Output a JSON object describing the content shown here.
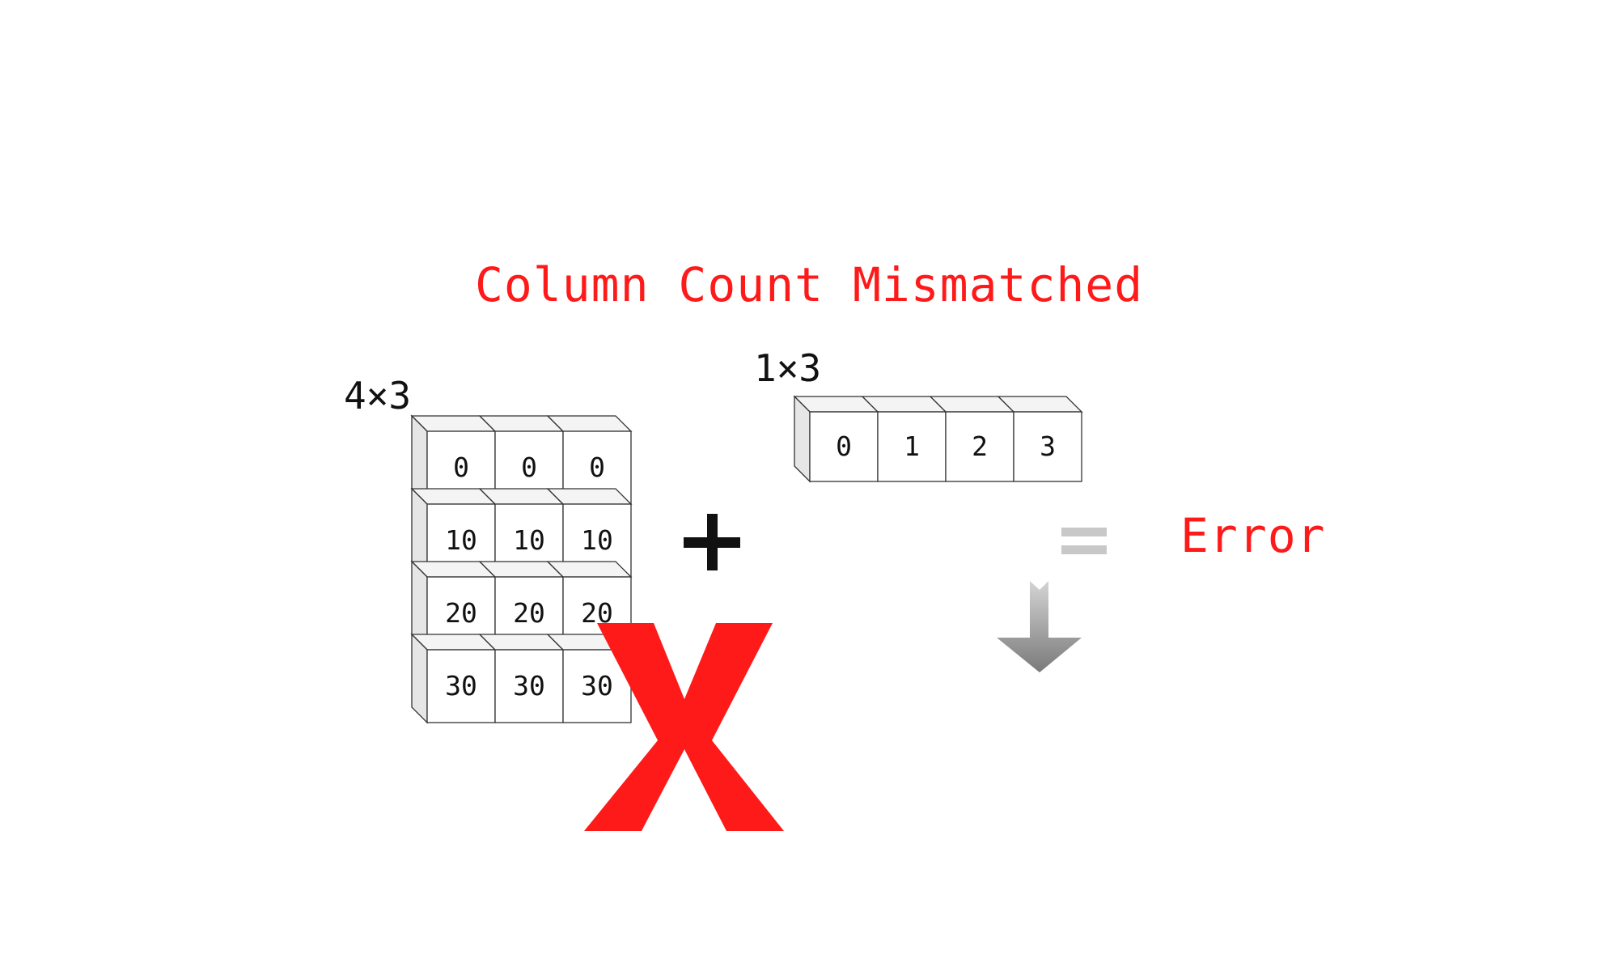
{
  "title": "Column Count Mismatched",
  "left_array": {
    "label": "4×3",
    "rows": [
      [
        "0",
        "0",
        "0"
      ],
      [
        "10",
        "10",
        "10"
      ],
      [
        "20",
        "20",
        "20"
      ],
      [
        "30",
        "30",
        "30"
      ]
    ]
  },
  "right_array": {
    "label": "1×3",
    "cells": [
      "0",
      "1",
      "2",
      "3"
    ]
  },
  "operator": "+",
  "equals": "=",
  "result": "Error",
  "colors": {
    "accent": "#ff1a1a",
    "text": "#111111",
    "cell_border": "#333333",
    "cell_side": "#e6e6e6",
    "arrow_light": "#d0d0d0",
    "arrow_dark": "#7a7a7a",
    "equals_color": "#c8c8c8"
  },
  "icons": {
    "operator": "plus-icon",
    "equals": "equals-icon",
    "arrow": "down-arrow-icon",
    "mismatch": "x-cross-icon"
  }
}
